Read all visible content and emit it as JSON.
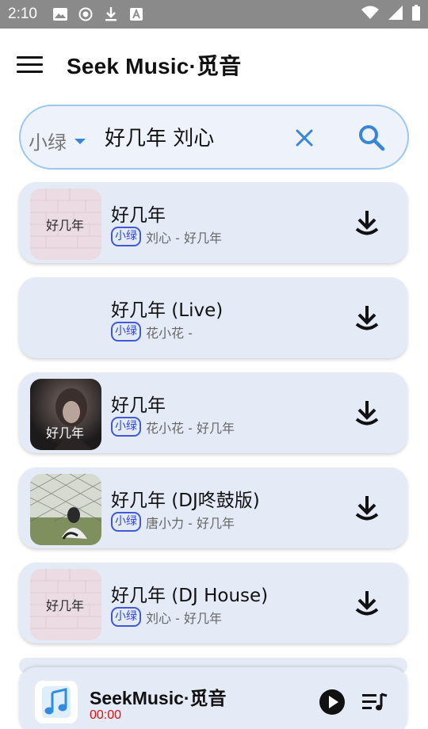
{
  "status_bar": {
    "time": "2:10",
    "left_icons": [
      "image-icon",
      "record-icon",
      "download-icon",
      "font-icon"
    ],
    "right_icons": [
      "wifi-icon",
      "cellular-signal-icon",
      "battery-icon"
    ]
  },
  "app_bar": {
    "title": "Seek Music·觅音",
    "menu_icon": "hamburger-menu-icon"
  },
  "search": {
    "source_selected": "小绿",
    "query": "好几年 刘心",
    "clear_icon": "close-icon",
    "search_icon": "search-icon"
  },
  "songs": [
    {
      "title": "好几年",
      "source": "小绿",
      "subtitle": "刘心 - 好几年",
      "cover": "pink-brick-cover"
    },
    {
      "title": "好几年 (Live)",
      "source": "小绿",
      "subtitle": "花小花 -",
      "cover": "none"
    },
    {
      "title": "好几年",
      "source": "小绿",
      "subtitle": "花小花 - 好几年",
      "cover": "portrait-cover"
    },
    {
      "title": "好几年 (DJ咚鼓版)",
      "source": "小绿",
      "subtitle": "唐小力 - 好几年",
      "cover": "fence-photo-cover"
    },
    {
      "title": "好几年 (DJ House)",
      "source": "小绿",
      "subtitle": "刘心 - 好几年",
      "cover": "pink-brick-cover"
    }
  ],
  "player": {
    "title": "SeekMusic·觅音",
    "time": "00:00",
    "play_icon": "play-icon",
    "queue_icon": "playlist-icon"
  },
  "colors": {
    "accent": "#3a86d6",
    "card_bg": "#e4eaf6",
    "badge": "#4159d8",
    "time_red": "#d11111",
    "status_bar": "#8a8a8a"
  }
}
